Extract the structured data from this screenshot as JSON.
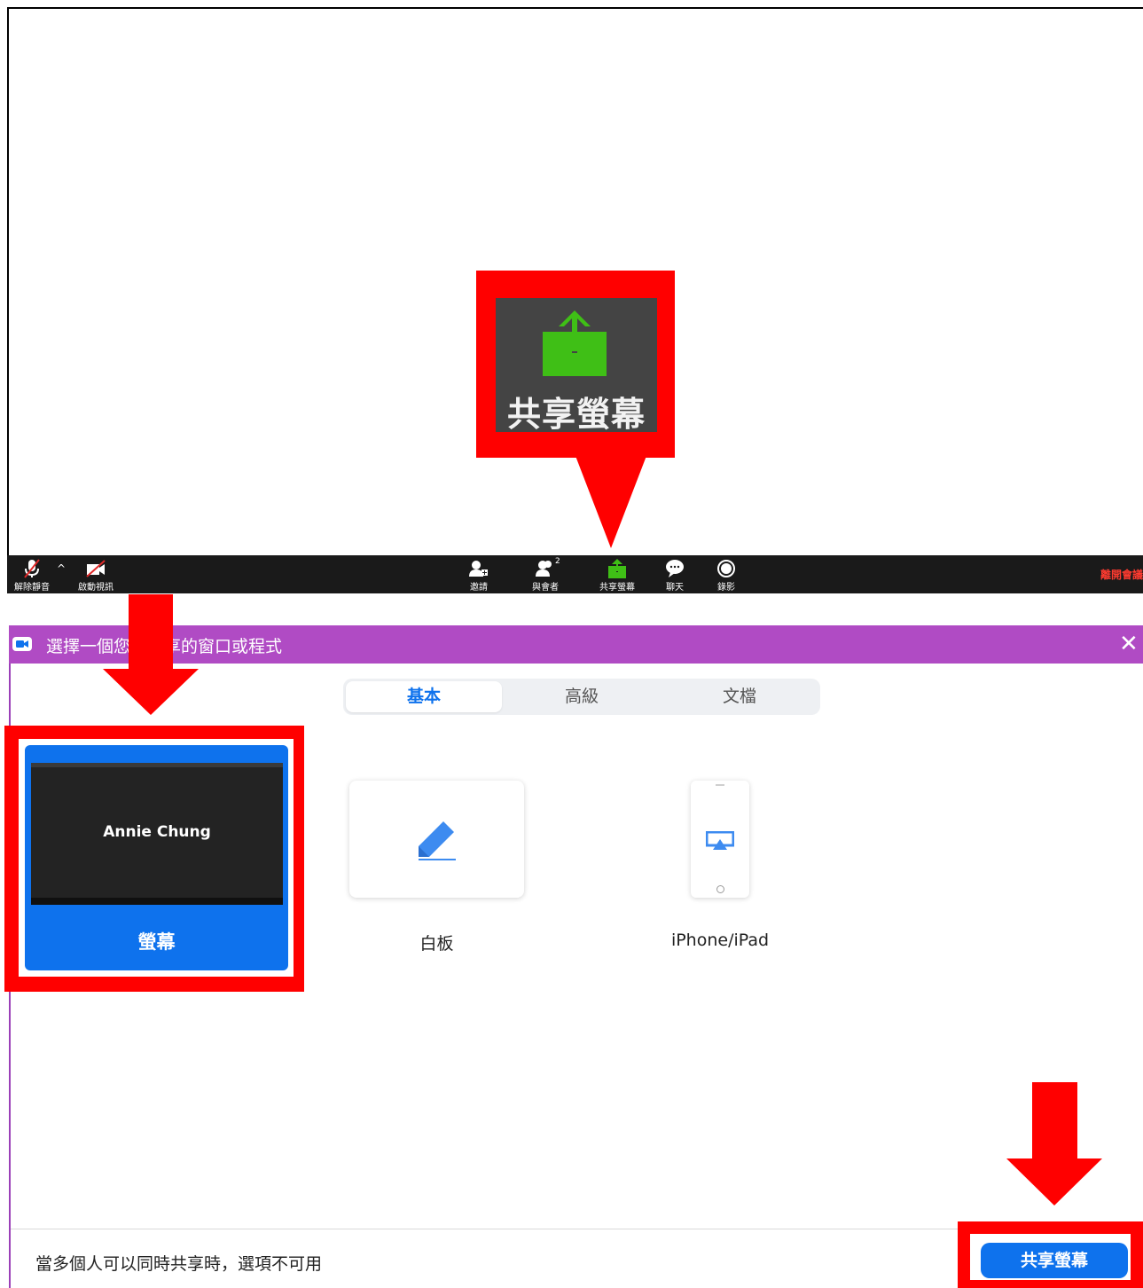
{
  "meeting": {
    "callout_label": "共享螢幕",
    "toolbar": {
      "unmute_label": "解除靜音",
      "video_label": "啟動視訊",
      "invite_label": "邀請",
      "participants_label": "與會者",
      "participants_count": "2",
      "share_label": "共享螢幕",
      "chat_label": "聊天",
      "record_label": "錄影",
      "leave_label": "離開會議"
    }
  },
  "dialog": {
    "title": "選擇一個您想共享的窗口或程式",
    "close_symbol": "✕",
    "tabs": [
      {
        "label": "基本",
        "active": true
      },
      {
        "label": "高級",
        "active": false
      },
      {
        "label": "文檔",
        "active": false
      }
    ],
    "options": {
      "screen": {
        "label": "螢幕",
        "thumbnail_name": "Annie Chung"
      },
      "whiteboard": {
        "label": "白板"
      },
      "iphone": {
        "label": "iPhone/iPad"
      }
    },
    "footer_note": "當多個人可以同時共享時，選項不可用",
    "share_button": "共享螢幕"
  },
  "colors": {
    "highlight": "#ff0000",
    "titlebar": "#b04bc4",
    "zoom_blue": "#0e72ed",
    "share_green": "#3fbf16",
    "toolbar_bg": "#1a1a1a"
  }
}
